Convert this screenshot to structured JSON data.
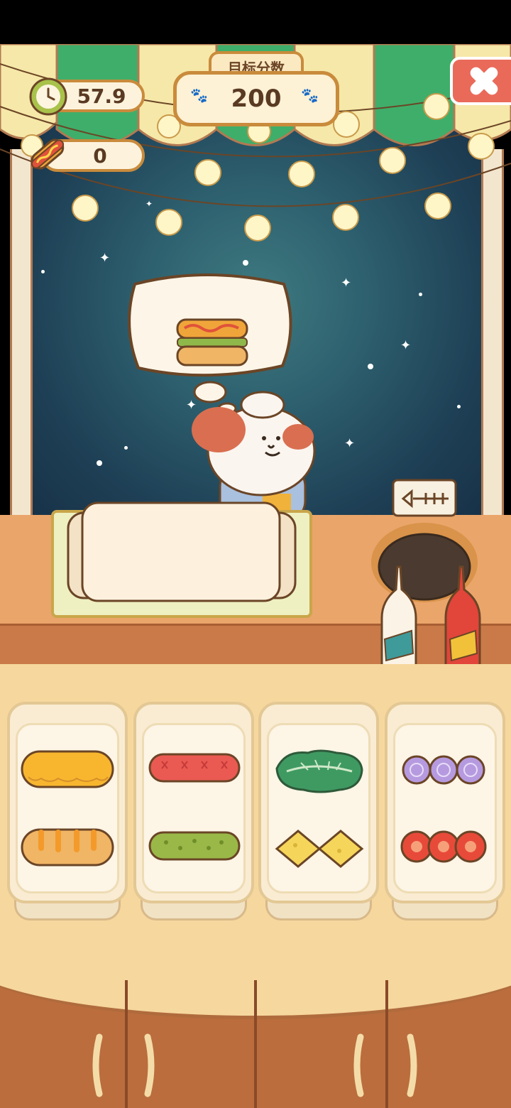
{
  "hud": {
    "timer": "57.9",
    "hotdog_count": "0",
    "target_label": "目标分数",
    "target_score": "200"
  },
  "order": {
    "item": "sandwich"
  },
  "ingredients": [
    {
      "name": "cheese"
    },
    {
      "name": "sausage"
    },
    {
      "name": "lettuce"
    },
    {
      "name": "onion"
    },
    {
      "name": "bread-roll"
    },
    {
      "name": "pickle"
    },
    {
      "name": "cheese-slice"
    },
    {
      "name": "tomato"
    }
  ],
  "colors": {
    "sky": "#2d5f6e",
    "wood": "#eaa56a",
    "accent": "#c98b3c",
    "close": "#ea6a5a"
  }
}
